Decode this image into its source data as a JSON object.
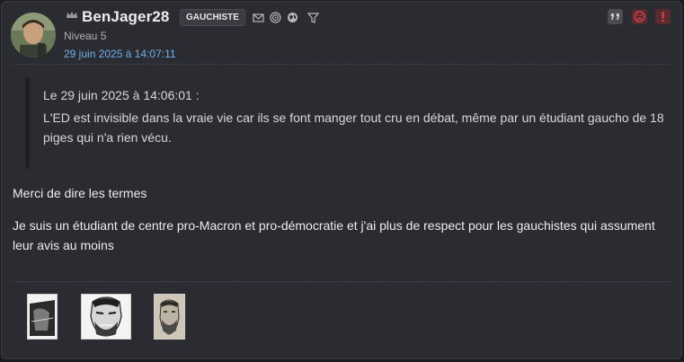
{
  "post": {
    "username": "BenJager28",
    "tag": "GAUCHISTE",
    "level": "Niveau 5",
    "timestamp": "29 juin 2025 à 14:07:11",
    "icons": [
      "crown-icon",
      "mail-icon",
      "spiral-icon",
      "globe-icon",
      "filter-icon",
      "quote-icon",
      "sad-face-icon",
      "alert-icon"
    ],
    "quote": {
      "header": "Le 29 juin 2025 à 14:06:01 :",
      "text": "L'ED est invisible dans la vraie vie car ils se font manger tout cru en débat, même par un étudiant gaucho de 18 piges qui n'a rien vécu."
    },
    "paragraphs": [
      "Merci de dire les termes",
      "Je suis un étudiant de centre pro-Macron et pro-démocratie et j'ai plus de respect pour les gauchistes qui assument leur avis au moins"
    ]
  },
  "colors": {
    "background": "#2a2c32",
    "timestamp": "#6fb0ea",
    "alert_button": "#5a2a2e",
    "alert_glyph": "#d9454f"
  }
}
